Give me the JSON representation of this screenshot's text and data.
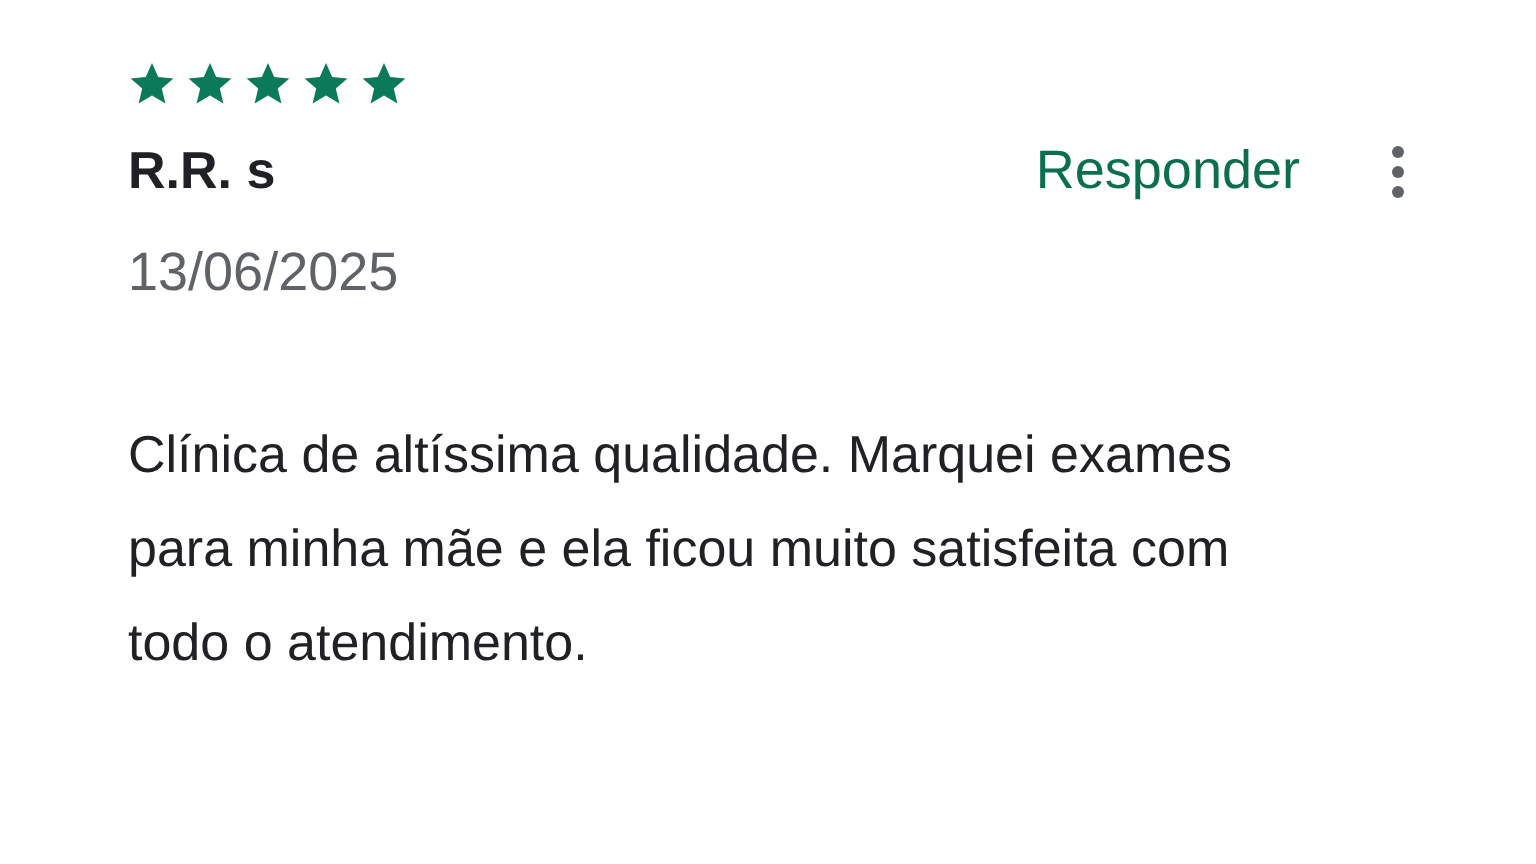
{
  "review": {
    "stars": 5,
    "author": "R.R. s",
    "reply_label": "Responder",
    "date": "13/06/2025",
    "text": "Clínica de altíssima qualidade. Marquei exames para minha mãe e ela ficou muito satisfeita com todo o atendimento."
  }
}
